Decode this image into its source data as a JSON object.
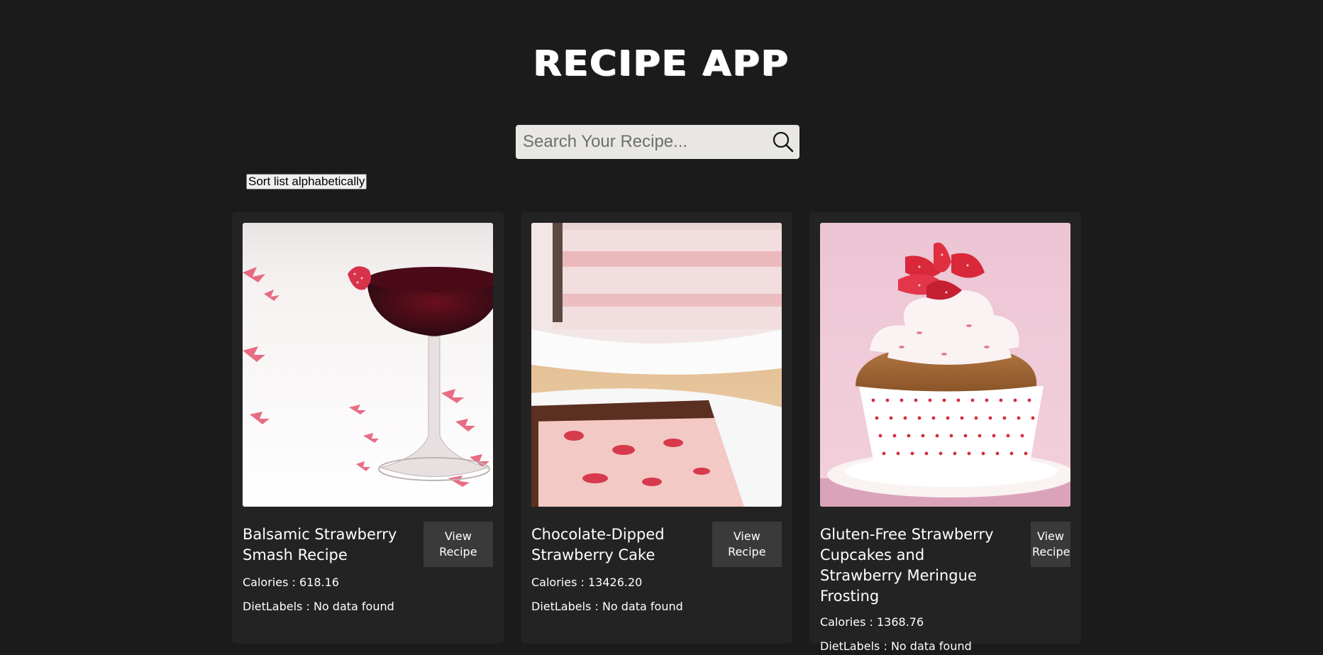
{
  "header": {
    "title": "RECIPE APP"
  },
  "search": {
    "placeholder": "Search Your Recipe...",
    "value": "",
    "icon": "search-icon"
  },
  "sort": {
    "label": "Sort list alphabetically"
  },
  "recipes": [
    {
      "title": "Balsamic Strawberry Smash Recipe",
      "view_label": "View Recipe",
      "calories": "Calories : 618.16",
      "diet": "DietLabels : No data found"
    },
    {
      "title": "Chocolate-Dipped Strawberry Cake",
      "view_label": "View Recipe",
      "calories": "Calories : 13426.20",
      "diet": "DietLabels : No data found"
    },
    {
      "title": "Gluten-Free Strawberry Cupcakes and Strawberry Meringue Frosting",
      "view_label": "View Recipe",
      "calories": "Calories : 1368.76",
      "diet": "DietLabels : No data found"
    }
  ],
  "colors": {
    "background": "#1b1b1b",
    "card": "#232323",
    "button": "#3a3a3a",
    "search_bg": "#e9e7e4"
  }
}
